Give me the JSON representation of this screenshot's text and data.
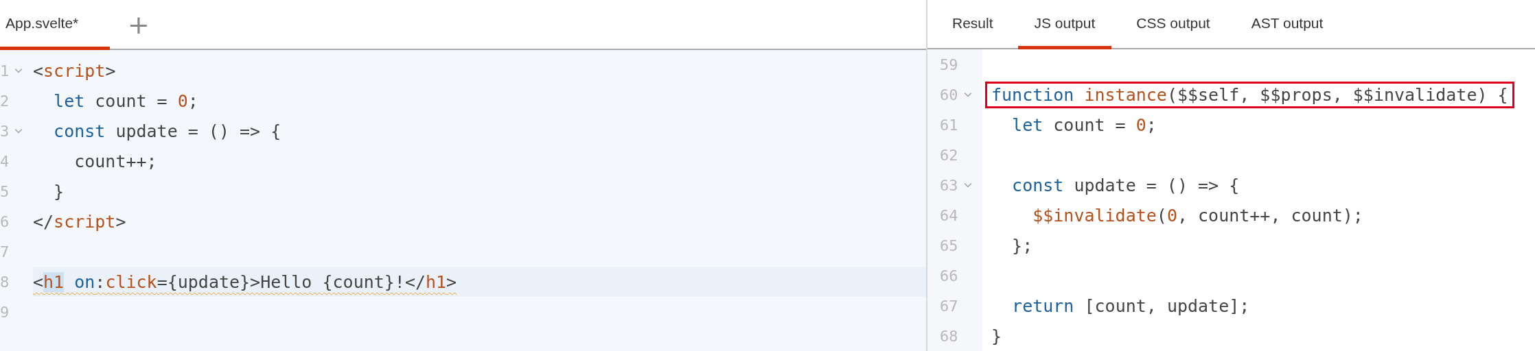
{
  "editor": {
    "tabs": [
      {
        "label": "App.svelte*",
        "selected": true
      }
    ],
    "add_tab": "+",
    "lines": [
      {
        "n": "1",
        "fold": true,
        "active": false,
        "warning": false,
        "tokens": [
          {
            "t": "<",
            "kind": "plain"
          },
          {
            "t": "script",
            "kind": "name"
          },
          {
            "t": ">",
            "kind": "plain"
          }
        ]
      },
      {
        "n": "2",
        "fold": false,
        "active": false,
        "warning": false,
        "tokens": [
          {
            "t": "  let",
            "kind": "keyword"
          },
          {
            "t": " count = ",
            "kind": "plain"
          },
          {
            "t": "0",
            "kind": "name"
          },
          {
            "t": ";",
            "kind": "plain"
          }
        ]
      },
      {
        "n": "3",
        "fold": true,
        "active": false,
        "warning": false,
        "tokens": [
          {
            "t": "  const",
            "kind": "keyword"
          },
          {
            "t": " update = () => {",
            "kind": "plain"
          }
        ]
      },
      {
        "n": "4",
        "fold": false,
        "active": false,
        "warning": false,
        "tokens": [
          {
            "t": "    count++;",
            "kind": "plain"
          }
        ]
      },
      {
        "n": "5",
        "fold": false,
        "active": false,
        "warning": false,
        "tokens": [
          {
            "t": "  }",
            "kind": "plain"
          }
        ]
      },
      {
        "n": "6",
        "fold": false,
        "active": false,
        "warning": false,
        "tokens": [
          {
            "t": "</",
            "kind": "plain"
          },
          {
            "t": "script",
            "kind": "name"
          },
          {
            "t": ">",
            "kind": "plain"
          }
        ]
      },
      {
        "n": "7",
        "fold": false,
        "active": false,
        "warning": false
      },
      {
        "n": "8",
        "fold": false,
        "active": true,
        "warning": true,
        "tokens": [
          {
            "t": "<",
            "kind": "plain"
          },
          {
            "t": "h1",
            "kind": "match"
          },
          {
            "t": " on",
            "kind": "keyword"
          },
          {
            "t": ":",
            "kind": "plain"
          },
          {
            "t": "click",
            "kind": "name"
          },
          {
            "t": "={update}>Hello {count}!</",
            "kind": "plain"
          },
          {
            "t": "h1",
            "kind": "name"
          },
          {
            "t": ">",
            "kind": "plain"
          }
        ]
      },
      {
        "n": "9",
        "fold": false,
        "active": false,
        "warning": false
      }
    ]
  },
  "output": {
    "tabs": [
      {
        "label": "Result",
        "selected": false
      },
      {
        "label": "JS output",
        "selected": true
      },
      {
        "label": "CSS output",
        "selected": false
      },
      {
        "label": "AST output",
        "selected": false
      }
    ],
    "lines": [
      {
        "n": "59",
        "fold": false,
        "boxed": false
      },
      {
        "n": "60",
        "fold": true,
        "boxed": true,
        "tokens": [
          {
            "t": "function ",
            "kind": "keyword"
          },
          {
            "t": "instance",
            "kind": "name"
          },
          {
            "t": "($$self, $$props, $$invalidate) {",
            "kind": "plain"
          }
        ]
      },
      {
        "n": "61",
        "fold": false,
        "boxed": false,
        "tokens": [
          {
            "t": "  let",
            "kind": "keyword"
          },
          {
            "t": " count = ",
            "kind": "plain"
          },
          {
            "t": "0",
            "kind": "name"
          },
          {
            "t": ";",
            "kind": "plain"
          }
        ]
      },
      {
        "n": "62",
        "fold": false,
        "boxed": false
      },
      {
        "n": "63",
        "fold": true,
        "boxed": false,
        "tokens": [
          {
            "t": "  const",
            "kind": "keyword"
          },
          {
            "t": " update = () => {",
            "kind": "plain"
          }
        ]
      },
      {
        "n": "64",
        "fold": false,
        "boxed": false,
        "tokens": [
          {
            "t": "    $$invalidate",
            "kind": "name"
          },
          {
            "t": "(",
            "kind": "plain"
          },
          {
            "t": "0",
            "kind": "name"
          },
          {
            "t": ", count++, count);",
            "kind": "plain"
          }
        ]
      },
      {
        "n": "65",
        "fold": false,
        "boxed": false,
        "tokens": [
          {
            "t": "  };",
            "kind": "plain"
          }
        ]
      },
      {
        "n": "66",
        "fold": false,
        "boxed": false
      },
      {
        "n": "67",
        "fold": false,
        "boxed": false,
        "tokens": [
          {
            "t": "  return",
            "kind": "keyword"
          },
          {
            "t": " [count, update];",
            "kind": "plain"
          }
        ]
      },
      {
        "n": "68",
        "fold": false,
        "boxed": false,
        "tokens": [
          {
            "t": "}",
            "kind": "plain"
          }
        ]
      }
    ]
  }
}
